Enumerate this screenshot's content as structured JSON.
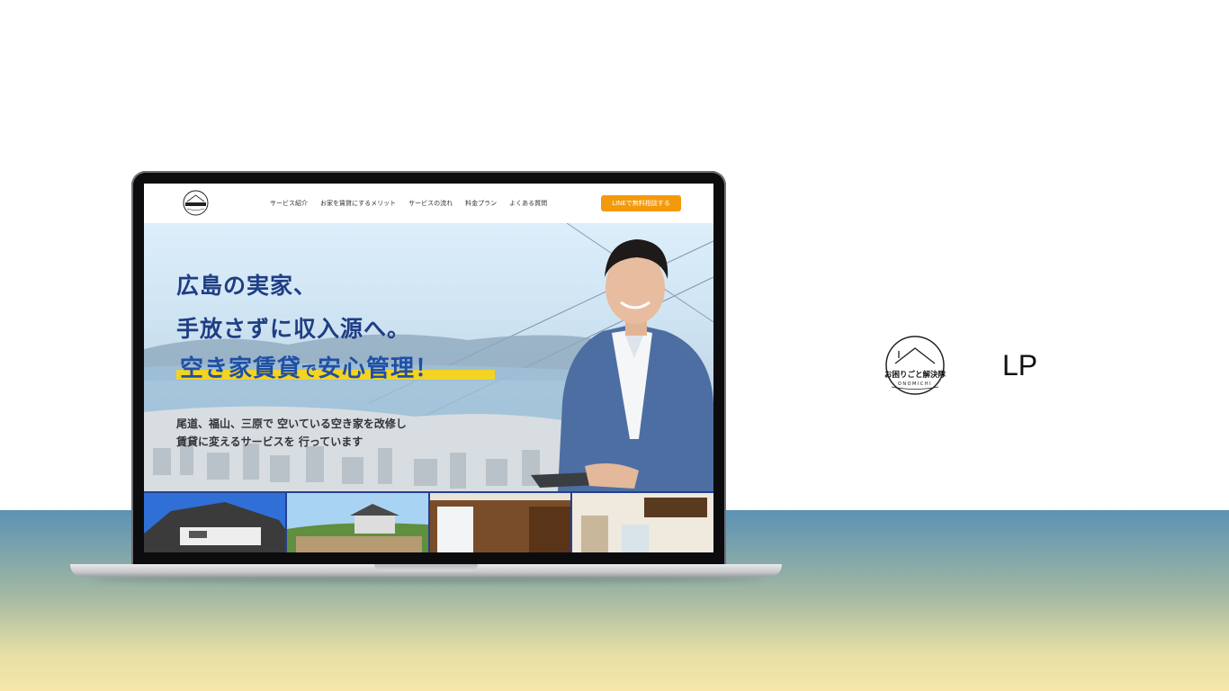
{
  "site": {
    "nav": [
      "サービス紹介",
      "お家を賃貸にするメリット",
      "サービスの流れ",
      "料金プラン",
      "よくある質問"
    ],
    "cta_label": "LINEで無料相談する",
    "logo_text": "お困りごと解決隊"
  },
  "hero": {
    "headline_line1": "広島の実家、",
    "headline_line2": "手放さずに収入源へ。",
    "tagline_part1": "空き家賃貸",
    "tagline_part2": "で",
    "tagline_part3": "安心管理！",
    "description_line1": "尾道、福山、三原で 空いている空き家を改修し",
    "description_line2": "賃貸に変えるサービスを 行っています"
  },
  "brand": {
    "name": "お困りごと解決隊",
    "subname": "ONOMICHI",
    "label": "LP"
  },
  "colors": {
    "cta": "#f39a0c",
    "headline": "#1f3e84",
    "highlight": "#f3d324",
    "thumb_border": "#25408f"
  }
}
